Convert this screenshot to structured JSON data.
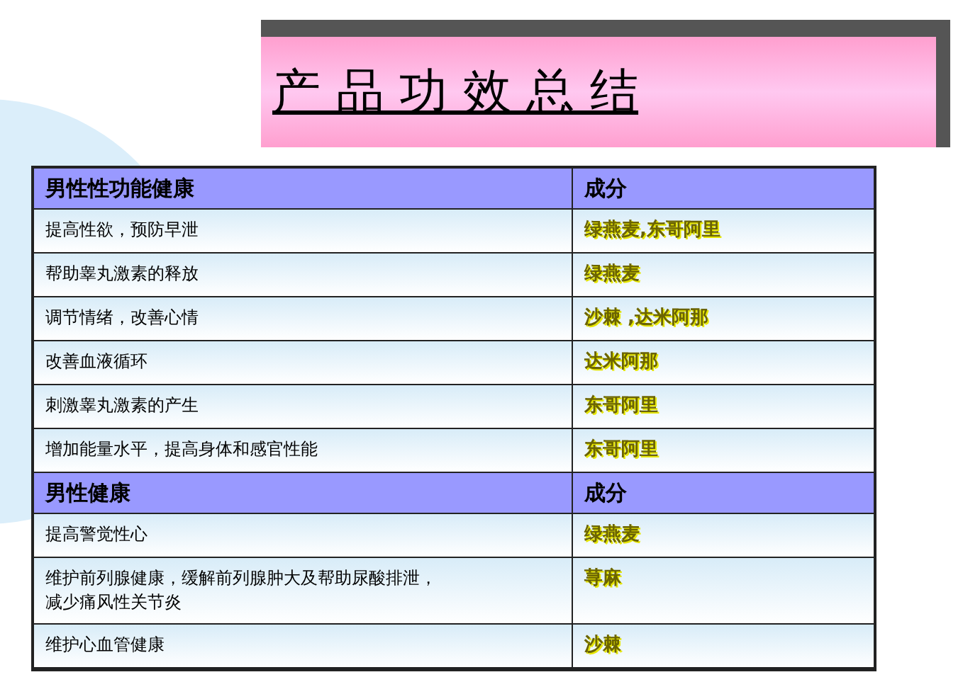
{
  "title": "产 品 功 效 总 结",
  "sections": [
    {
      "header": {
        "column_1": "男性性功能健康",
        "column_2": "成分"
      },
      "rows": [
        {
          "benefit": "提高性欲，预防早泄",
          "ingredient": "绿燕麦,东哥阿里"
        },
        {
          "benefit": "帮助睾丸激素的释放",
          "ingredient": "绿燕麦"
        },
        {
          "benefit": "调节情绪，改善心情",
          "ingredient": "沙棘 ,达米阿那"
        },
        {
          "benefit": "改善血液循环",
          "ingredient": "达米阿那"
        },
        {
          "benefit": "刺激睾丸激素的产生",
          "ingredient": "东哥阿里"
        },
        {
          "benefit": "增加能量水平，提高身体和感官性能",
          "ingredient": "东哥阿里"
        }
      ]
    },
    {
      "header": {
        "column_1": "男性健康",
        "column_2": "成分"
      },
      "rows": [
        {
          "benefit": "提高警觉性心",
          "ingredient": "绿燕麦"
        },
        {
          "benefit": "维护前列腺健康，缓解前列腺肿大及帮助尿酸排泄，",
          "benefit_continued": "减少痛风性关节炎",
          "ingredient": "荨麻"
        },
        {
          "benefit": "维护心血管健康",
          "ingredient": "沙棘"
        }
      ]
    }
  ]
}
